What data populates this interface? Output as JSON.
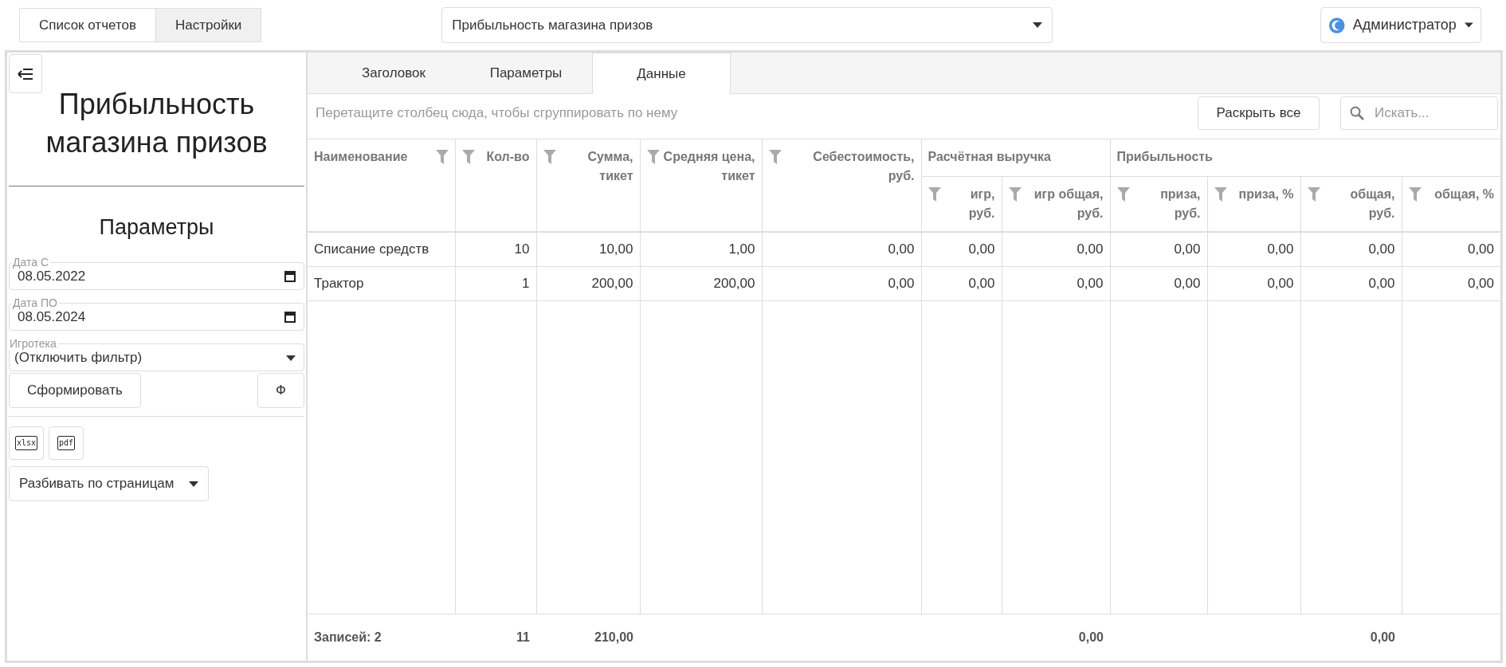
{
  "top_tabs": [
    {
      "label": "Список отчетов",
      "selected": false
    },
    {
      "label": "Настройки",
      "selected": true
    }
  ],
  "report_select": {
    "value": "Прибыльность магазина призов"
  },
  "user_menu": {
    "label": "Администратор"
  },
  "sidebar": {
    "title": "Прибыльность магазина призов",
    "params_heading": "Параметры",
    "fields": [
      {
        "kind": "date",
        "label": "Дата С",
        "value": "08.05.2022"
      },
      {
        "kind": "date",
        "label": "Дата ПО",
        "value": "08.05.2024"
      },
      {
        "kind": "select",
        "label": "Игротека",
        "value": "(Отключить фильтр)"
      }
    ],
    "generate_button": "Сформировать",
    "f_button": "Ф",
    "export_buttons": [
      {
        "label": "xlsx"
      },
      {
        "label": "pdf"
      }
    ],
    "paging_select": {
      "value": "Разбивать по страницам"
    }
  },
  "tabs": [
    {
      "label": "Заголовок",
      "selected": false
    },
    {
      "label": "Параметры",
      "selected": false
    },
    {
      "label": "Данные",
      "selected": true
    }
  ],
  "grid": {
    "group_hint": "Перетащите столбец сюда, чтобы сгруппировать по нему",
    "expand_button": "Раскрыть все",
    "search": {
      "placeholder": "Искать..."
    },
    "header": [
      {
        "label": "Наименование",
        "kind": "text",
        "total": "Записей: 2"
      },
      {
        "label": "Кол-во",
        "kind": "number",
        "total": "11"
      },
      {
        "label": "Сумма, тикет",
        "kind": "number",
        "total": "210,00"
      },
      {
        "label": "Средняя цена, тикет",
        "kind": "number"
      },
      {
        "label": "Себестоимость, руб.",
        "kind": "number"
      },
      {
        "group": "Расчётная выручка",
        "columns": [
          {
            "label": "игр, руб.",
            "kind": "number"
          },
          {
            "label": "игр общая, руб.",
            "kind": "number",
            "total": "0,00"
          }
        ]
      },
      {
        "group": "Прибыльность",
        "columns": [
          {
            "label": "приза, руб.",
            "kind": "number"
          },
          {
            "label": "приза, %",
            "kind": "number"
          },
          {
            "label": "общая, руб.",
            "kind": "number",
            "total": "0,00"
          },
          {
            "label": "общая, %",
            "kind": "number"
          }
        ]
      }
    ],
    "rows": [
      [
        "Списание средств",
        "10",
        "10,00",
        "1,00",
        "0,00",
        "0,00",
        "0,00",
        "0,00",
        "0,00",
        "0,00",
        "0,00"
      ],
      [
        "Трактор",
        "1",
        "200,00",
        "200,00",
        "0,00",
        "0,00",
        "0,00",
        "0,00",
        "0,00",
        "0,00",
        "0,00"
      ]
    ]
  }
}
